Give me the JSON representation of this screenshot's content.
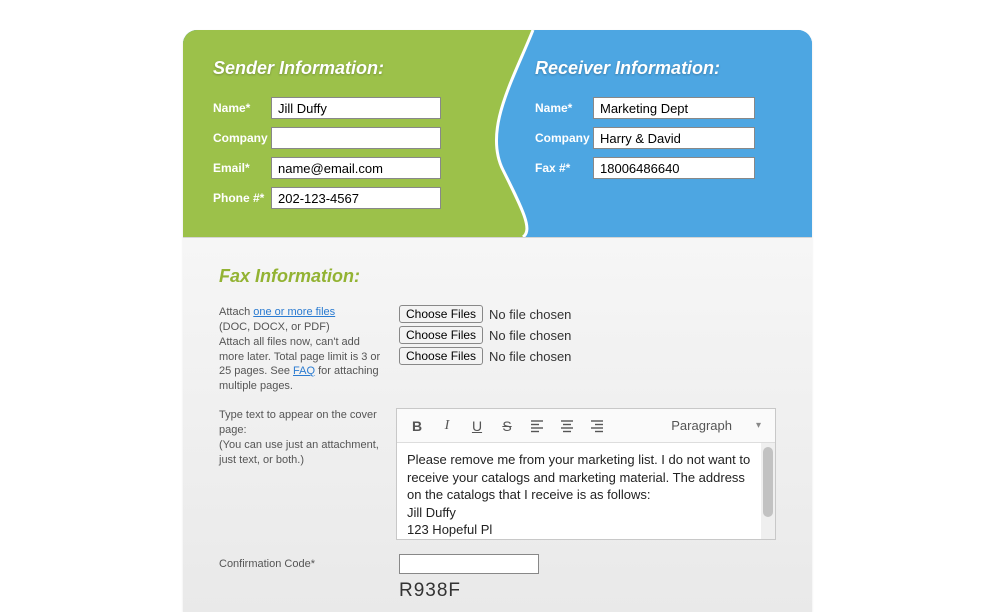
{
  "sender": {
    "title": "Sender Information:",
    "name_label": "Name*",
    "name_value": "Jill Duffy",
    "company_label": "Company",
    "company_value": "",
    "email_label": "Email*",
    "email_value": "name@email.com",
    "phone_label": "Phone #*",
    "phone_value": "202-123-4567"
  },
  "receiver": {
    "title": "Receiver Information:",
    "name_label": "Name*",
    "name_value": "Marketing Dept",
    "company_label": "Company",
    "company_value": "Harry & David",
    "fax_label": "Fax #*",
    "fax_value": "18006486640"
  },
  "fax": {
    "title": "Fax Information:",
    "attach_prefix": "Attach ",
    "attach_link": "one or more files",
    "attach_note": "(DOC, DOCX, or PDF)\nAttach all files now, can't add more later. Total page limit is 3 or 25 pages. See ",
    "faq_link": "FAQ",
    "attach_note_suffix": " for attaching multiple pages.",
    "choose_label": "Choose Files",
    "no_file": "No file chosen",
    "cover_note": "Type text to appear on the cover page:\n(You can use just an attachment, just text, or both.)",
    "paragraph_label": "Paragraph",
    "editor_text": "Please remove me from your marketing list. I do not want to receive your catalogs and marketing material. The address on the catalogs that I receive is as follows:\nJill Duffy\n123 Hopeful Pl",
    "confirmation_label": "Confirmation Code*",
    "confirmation_value": "",
    "captcha": "R938F"
  }
}
